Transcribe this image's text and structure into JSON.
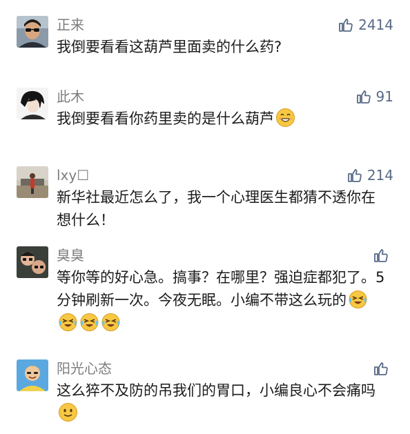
{
  "comments": [
    {
      "user": "正来",
      "likes": "2414",
      "text": "我倒要看看这葫芦里面卖的什么药?",
      "emoji": []
    },
    {
      "user": "此木",
      "likes": "91",
      "text": "我倒要看看你药里卖的是什么葫芦",
      "emoji": [
        "grinning-face-emoji"
      ]
    },
    {
      "user": "lxy☐",
      "likes": "214",
      "text": "新华社最近怎么了，我一个心理医生都猜不透你在想什么！",
      "emoji": []
    },
    {
      "user": "臭臭",
      "likes": "",
      "text": "等你等的好心急。搞事？在哪里？强迫症都犯了。5分钟刷新一次。今夜无眠。小编不带这么玩的",
      "emoji": [
        "laughing-crying-emoji",
        "laughing-crying-emoji",
        "laughing-crying-emoji",
        "laughing-crying-emoji"
      ]
    },
    {
      "user": "阳光心态",
      "likes": "",
      "text": "这么猝不及防的吊我们的胃口，小编良心不会痛吗",
      "emoji": [
        "smiling-face-emoji"
      ]
    }
  ],
  "icons": {
    "like": "thumbs-up-icon"
  },
  "colors": {
    "like": "#586a86",
    "name": "#7d7d7d",
    "text": "#1b1b1b"
  }
}
